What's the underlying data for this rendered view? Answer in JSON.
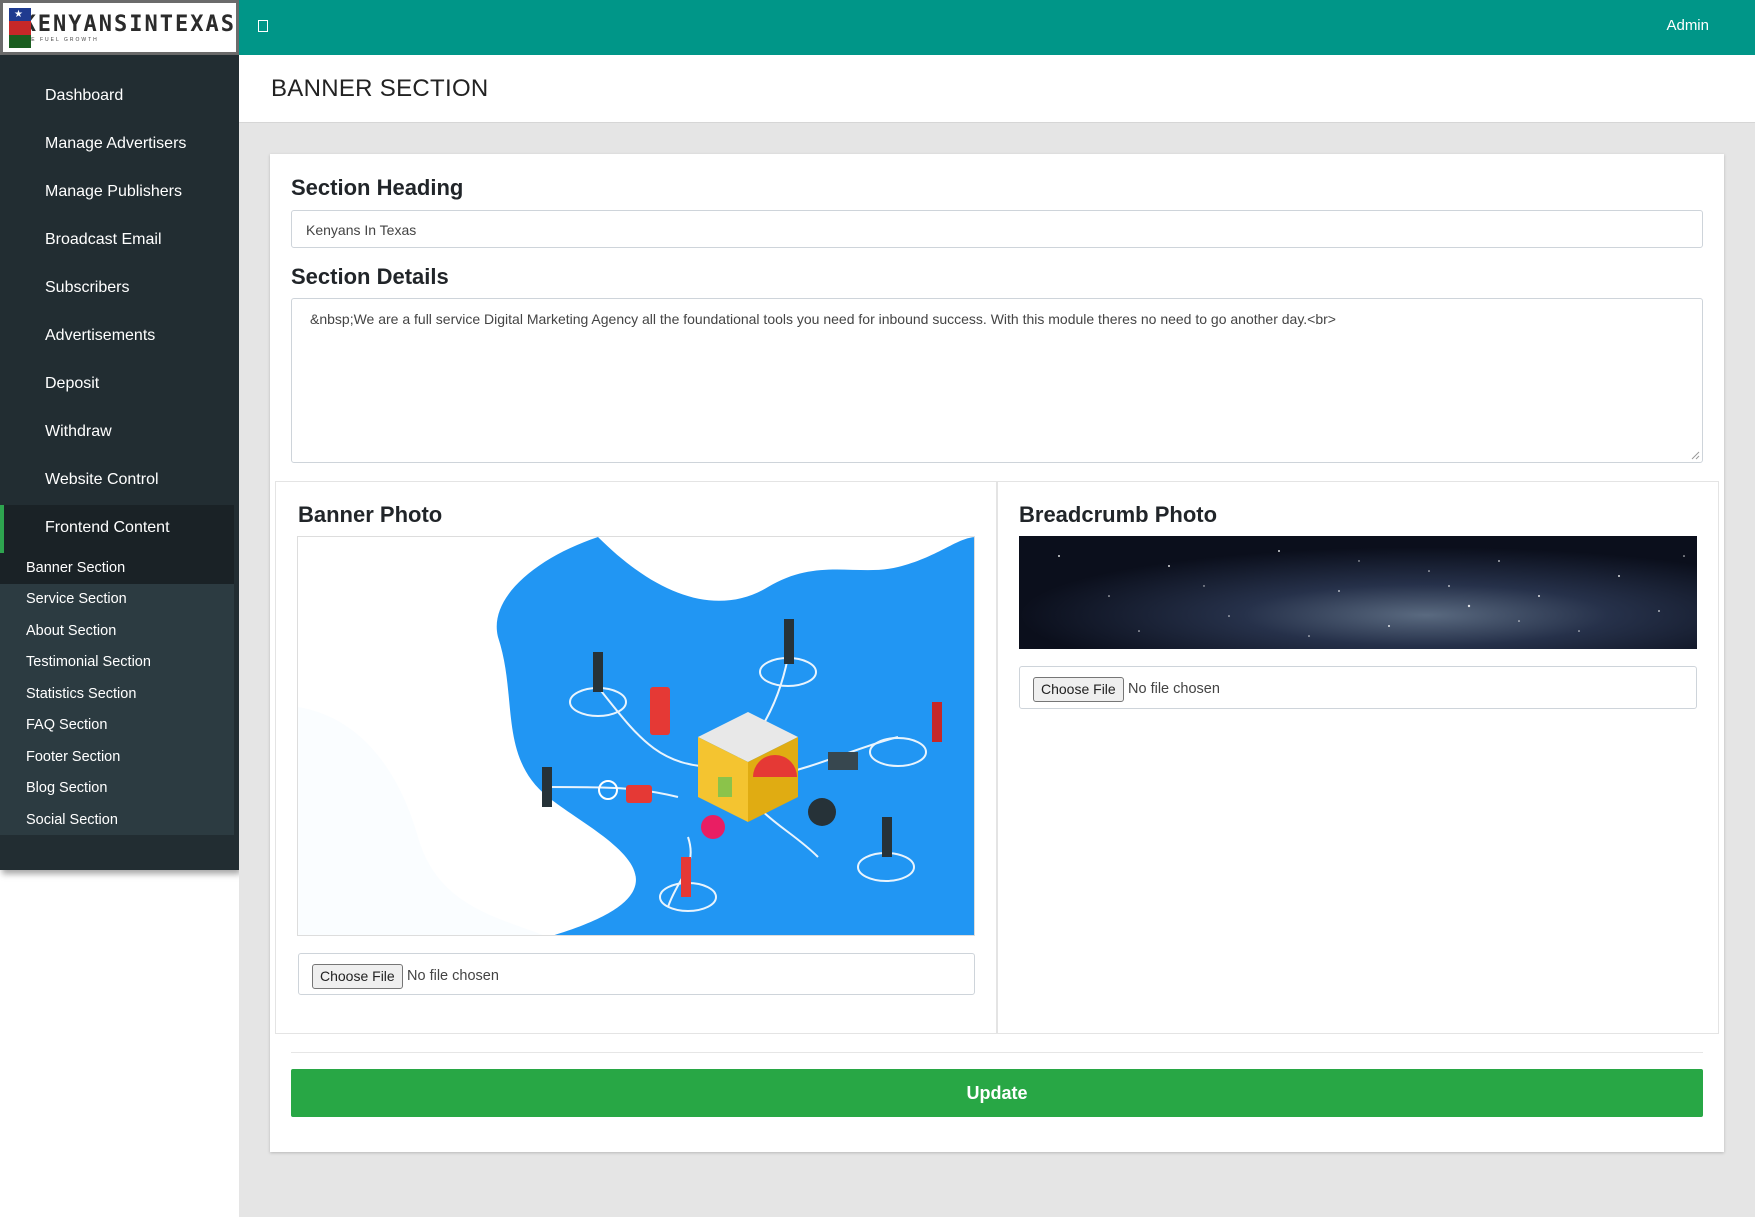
{
  "brand": {
    "name": "KENYANSINTEXAS",
    "tagline": "WE FUEL GROWTH"
  },
  "topbar": {
    "user": "Admin"
  },
  "sidebar": {
    "items": [
      {
        "label": "Dashboard"
      },
      {
        "label": "Manage Advertisers"
      },
      {
        "label": "Manage Publishers"
      },
      {
        "label": "Broadcast Email"
      },
      {
        "label": "Subscribers"
      },
      {
        "label": "Advertisements"
      },
      {
        "label": "Deposit"
      },
      {
        "label": "Withdraw"
      },
      {
        "label": "Website Control"
      },
      {
        "label": "Frontend Content",
        "active": true
      }
    ],
    "submenu": [
      {
        "label": "Banner Section",
        "active": true
      },
      {
        "label": "Service Section"
      },
      {
        "label": "About Section"
      },
      {
        "label": "Testimonial Section"
      },
      {
        "label": "Statistics Section"
      },
      {
        "label": "FAQ Section"
      },
      {
        "label": "Footer Section"
      },
      {
        "label": "Blog Section"
      },
      {
        "label": "Social Section"
      }
    ]
  },
  "page": {
    "title": "BANNER SECTION"
  },
  "form": {
    "heading_label": "Section Heading",
    "heading_value": "Kenyans In Texas",
    "details_label": "Section Details",
    "details_value": "&nbsp;We are a full service Digital Marketing Agency all the foundational tools you need for inbound success. With this module theres no need to go another day.<br>",
    "banner_photo_label": "Banner Photo",
    "breadcrumb_photo_label": "Breadcrumb Photo",
    "choose_file_label": "Choose File",
    "no_file_text": "No file chosen",
    "update_label": "Update"
  },
  "colors": {
    "topbar": "#009688",
    "sidebar": "#222d32",
    "submenu": "#2c3b41",
    "active_indicator": "#2ea44f",
    "update_button": "#28a745",
    "banner_blue": "#2196f3"
  }
}
